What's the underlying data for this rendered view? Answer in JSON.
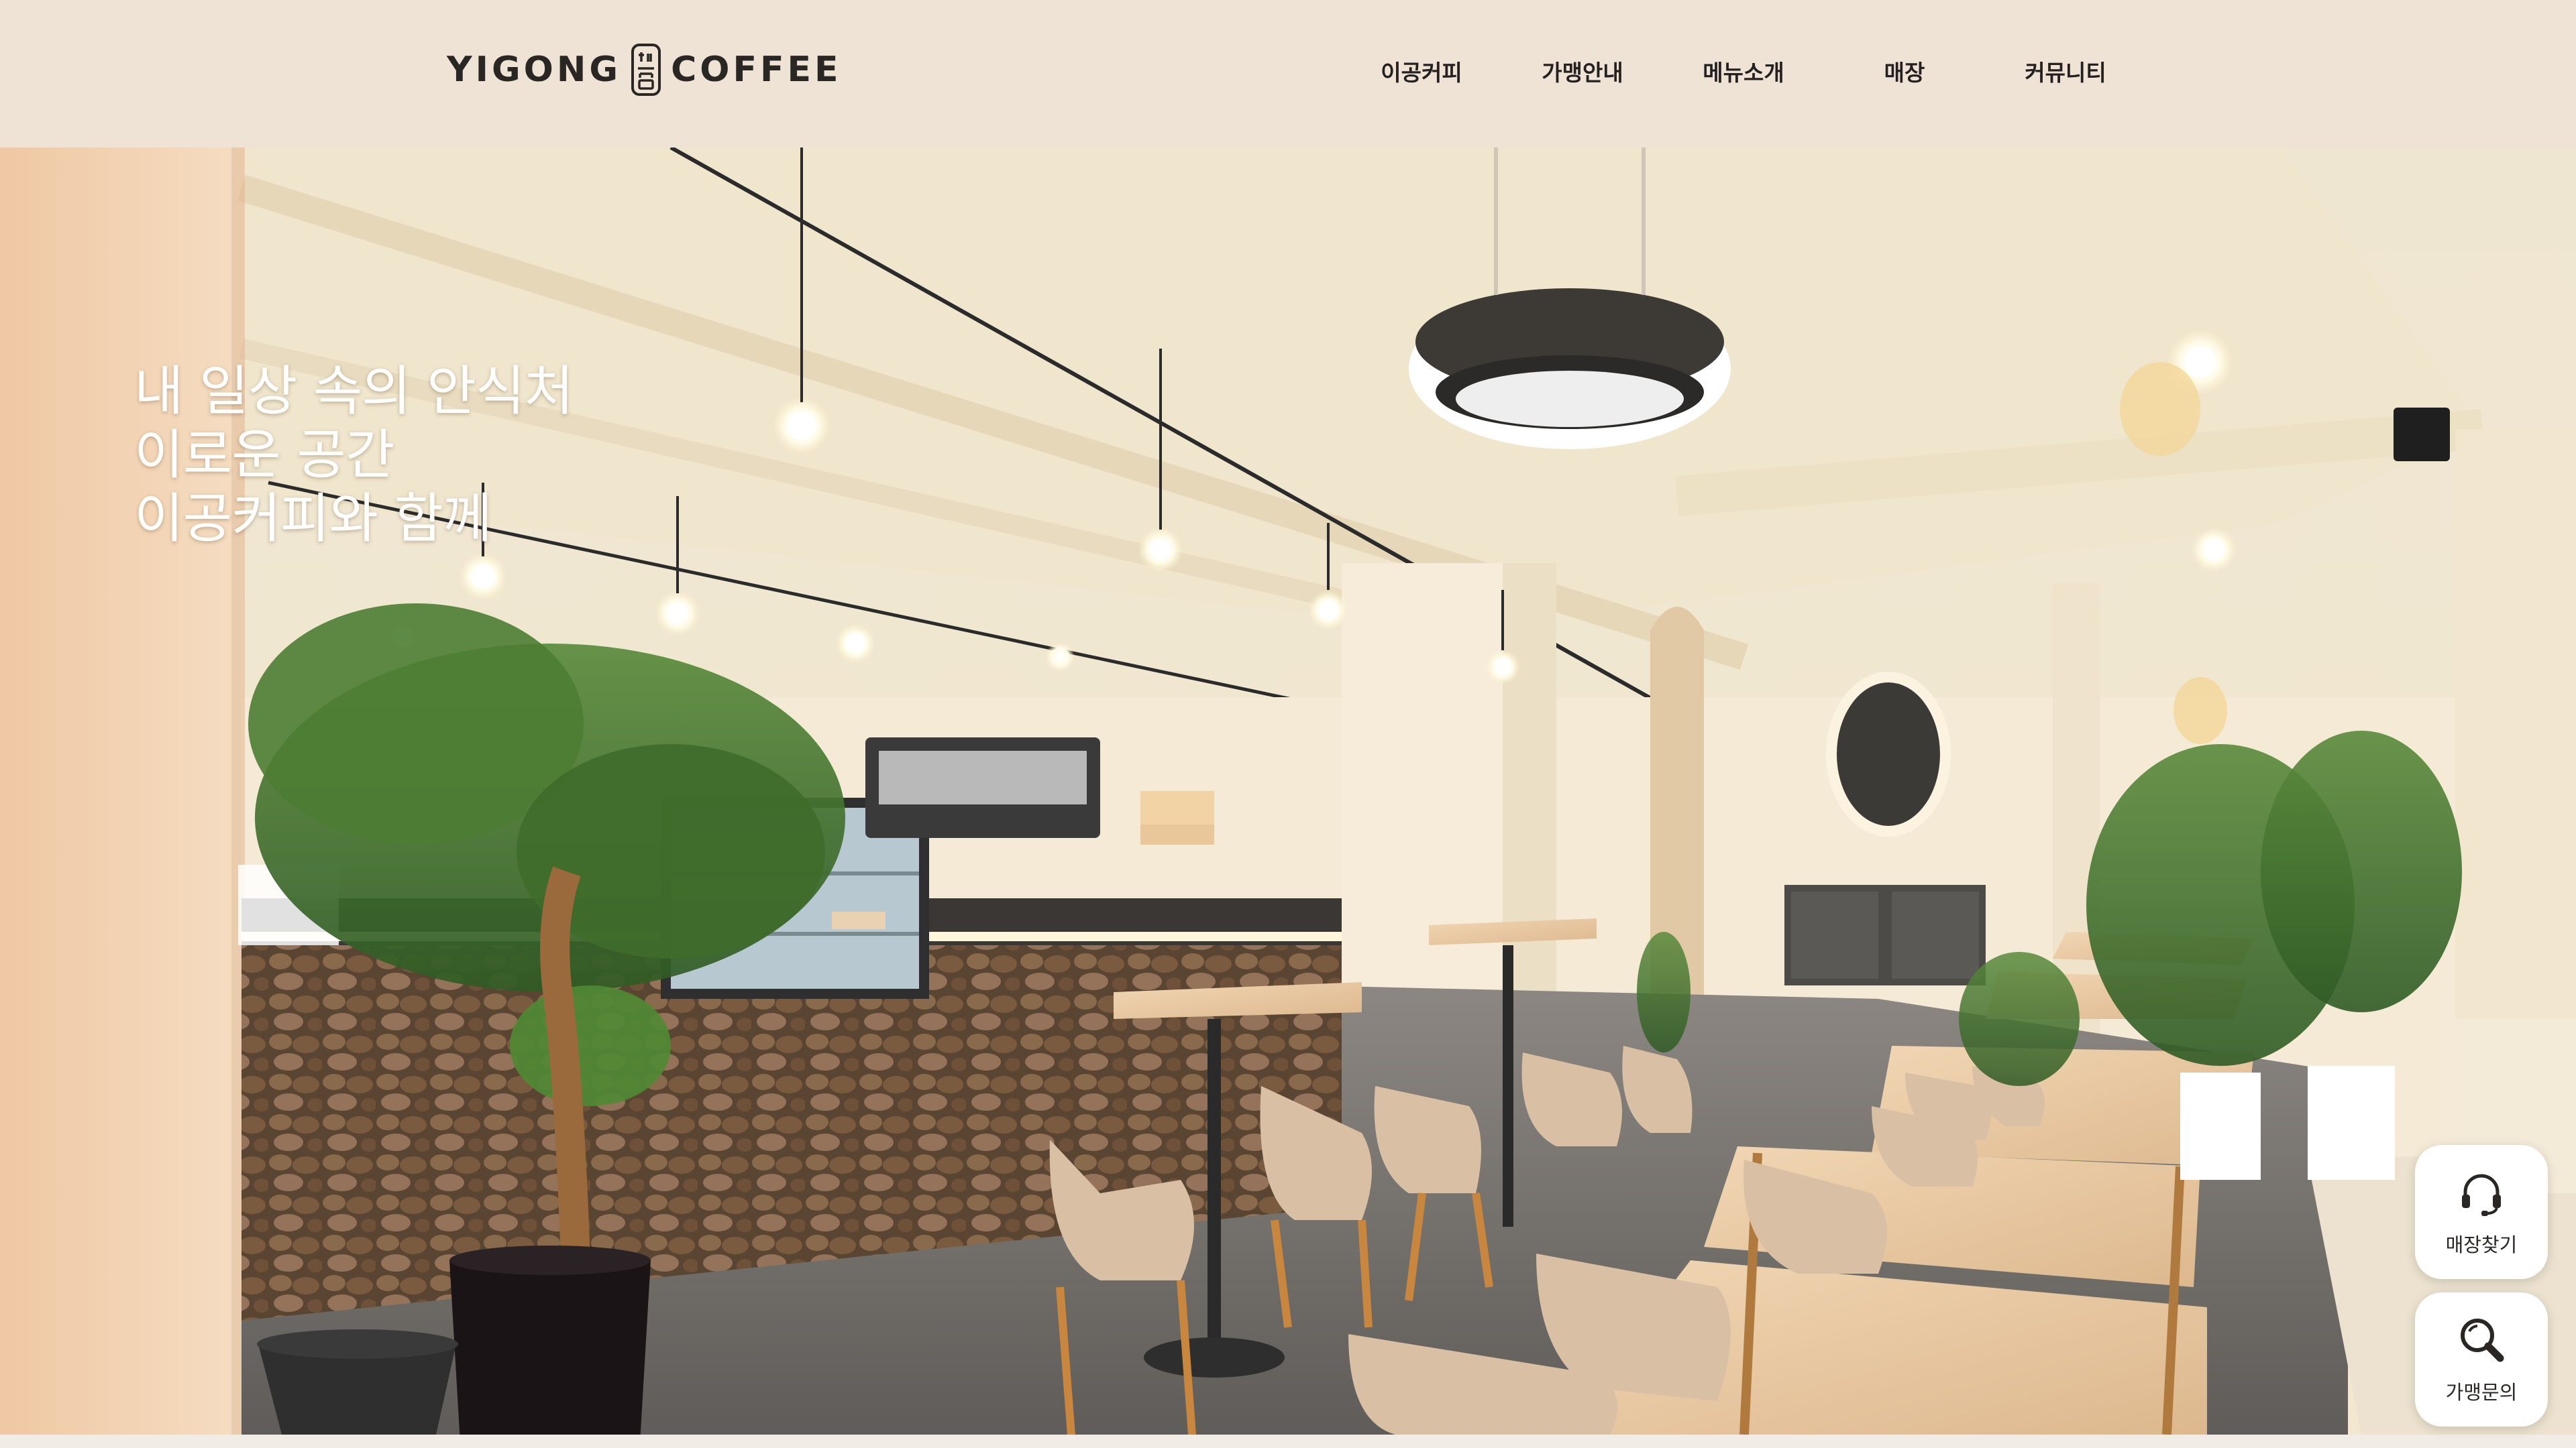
{
  "header": {
    "brand_left": "YIGONG",
    "brand_right": "COFFEE",
    "nav": [
      {
        "label": "이공커피"
      },
      {
        "label": "가맹안내"
      },
      {
        "label": "메뉴소개"
      },
      {
        "label": "매장"
      },
      {
        "label": "커뮤니티"
      }
    ]
  },
  "hero": {
    "lines": [
      "내 일상 속의 안식처",
      "이로운 공간",
      "이공커피와 함께"
    ],
    "image_subject": "cafe-interior-photo"
  },
  "floating": {
    "store_finder": {
      "label": "매장찾기",
      "icon": "headset-icon"
    },
    "franchise_inquiry": {
      "label": "가맹문의",
      "icon": "magnifier-icon"
    }
  },
  "colors": {
    "header_bg": "#efe3d6",
    "text_dark": "#242120",
    "hero_text": "#ffffff"
  }
}
